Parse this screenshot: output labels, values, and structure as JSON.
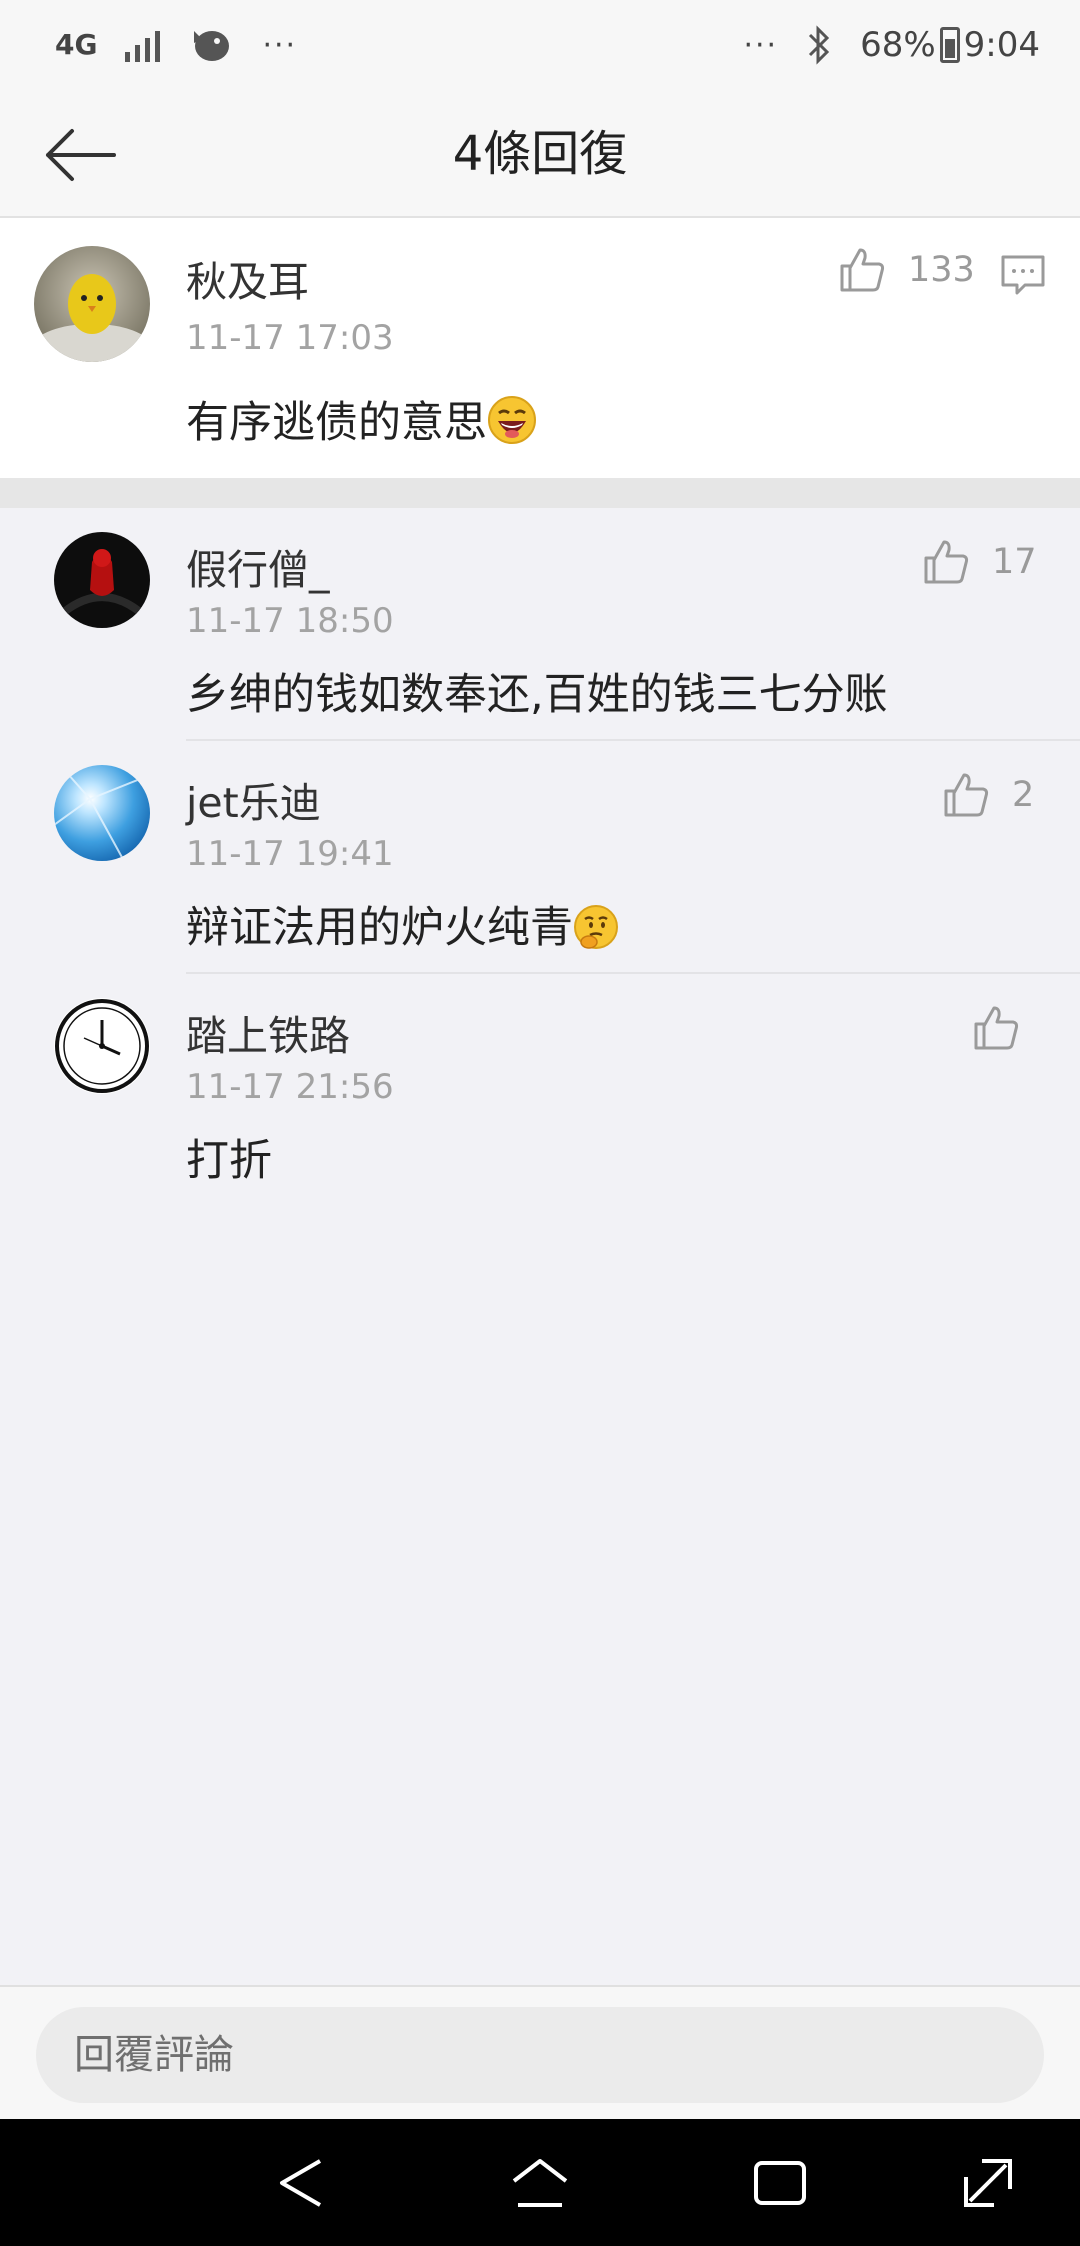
{
  "status_bar": {
    "network": "4G",
    "more_left": "···",
    "more_right": "···",
    "battery": "68%",
    "time": "9:04",
    "icons": [
      "network-4g-icon",
      "signal-icon",
      "app-notification-icon",
      "bluetooth-icon",
      "battery-icon"
    ]
  },
  "header": {
    "title": "4條回復",
    "back_icon": "back-arrow-icon"
  },
  "main_comment": {
    "username": "秋及耳",
    "time": "11-17 17:03",
    "text": "有序逃债的意思",
    "emoji": "laughing-emoji",
    "likes": "133",
    "avatar_color": "#e8c81a"
  },
  "replies": [
    {
      "username": "假行僧_",
      "time": "11-17 18:50",
      "text": "乡绅的钱如数奉还,百姓的钱三七分账",
      "likes": "17",
      "avatar": "spider-avatar"
    },
    {
      "username": "jet乐迪",
      "time": "11-17 19:41",
      "text": "辩证法用的炉火纯青",
      "emoji": "thinking-emoji",
      "likes": "2",
      "avatar": "sunburst-avatar"
    },
    {
      "username": "踏上铁路",
      "time": "11-17 21:56",
      "text": "打折",
      "likes": "",
      "avatar": "clock-avatar"
    }
  ],
  "input": {
    "placeholder": "回覆評論"
  },
  "nav": {
    "icons": [
      "nav-back-icon",
      "nav-home-icon",
      "nav-recents-icon",
      "nav-expand-icon"
    ]
  },
  "colors": {
    "accent_text": "#222222",
    "meta_text": "#a3a3a3",
    "icon_gray": "#9a9a9a"
  }
}
